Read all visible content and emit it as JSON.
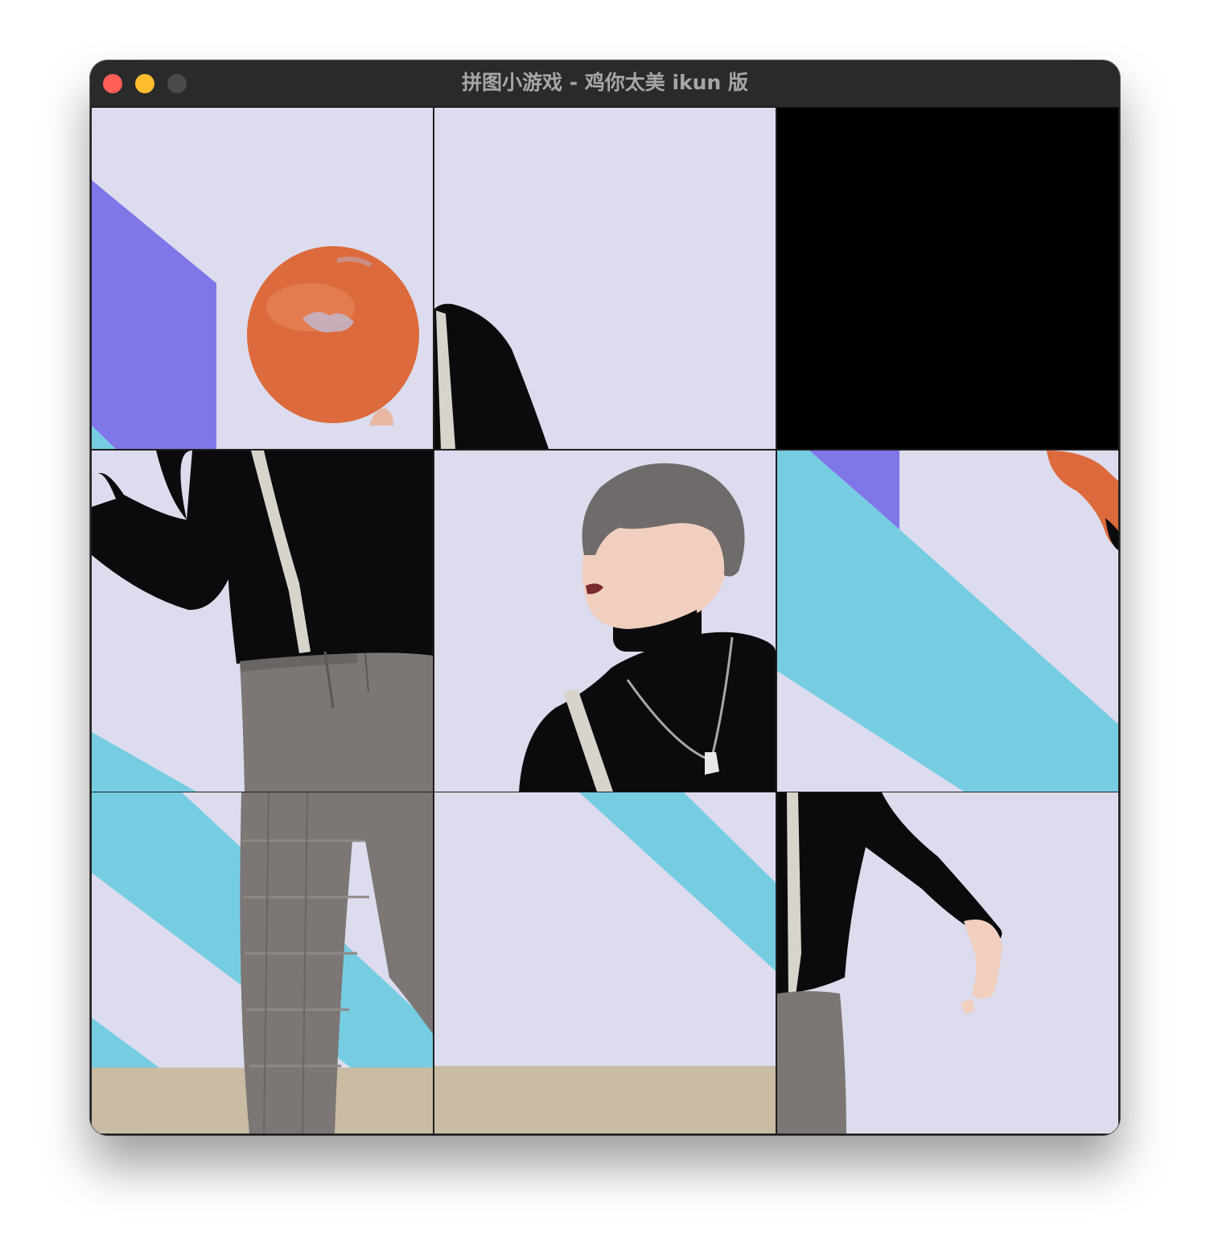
{
  "window": {
    "title": "拼图小游戏 - 鸡你太美 ikun 版",
    "buttons": {
      "close_color": "#fe5f57",
      "minimize_color": "#febc2e",
      "maximize_color": "#4a4a4a"
    }
  },
  "puzzle": {
    "grid_size": 3,
    "empty_tile": {
      "row": 0,
      "col": 2
    },
    "tiles": [
      {
        "row": 0,
        "col": 0,
        "content": "basketball-spinning"
      },
      {
        "row": 0,
        "col": 1,
        "content": "black-sleeve-arm"
      },
      {
        "row": 0,
        "col": 2,
        "content": "empty"
      },
      {
        "row": 1,
        "col": 0,
        "content": "torso-suspenders"
      },
      {
        "row": 1,
        "col": 1,
        "content": "face-turtleneck"
      },
      {
        "row": 1,
        "col": 2,
        "content": "cyan-stripes-hand"
      },
      {
        "row": 2,
        "col": 0,
        "content": "plaid-trousers"
      },
      {
        "row": 2,
        "col": 1,
        "content": "stripe-floor"
      },
      {
        "row": 2,
        "col": 2,
        "content": "arm-hand-trousers"
      }
    ]
  },
  "colors": {
    "background": "#dcdcee",
    "purple_stripe": "#7f77e8",
    "cyan_stripe": "#76cde2",
    "floor": "#c9bba4",
    "clothing": "#0b0b0d",
    "trousers": "#7c7674",
    "ball": "#dc6a3c"
  }
}
